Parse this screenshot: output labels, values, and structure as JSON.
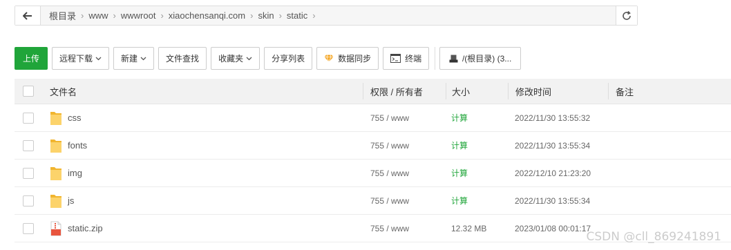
{
  "breadcrumb": [
    "根目录",
    "www",
    "wwwroot",
    "xiaochensanqi.com",
    "skin",
    "static"
  ],
  "toolbar": {
    "upload": "上传",
    "remote_download": "远程下载",
    "new": "新建",
    "file_search": "文件查找",
    "favorites": "收藏夹",
    "share_list": "分享列表",
    "data_sync": "数据同步",
    "terminal": "终端",
    "disk": "/(根目录) (3..."
  },
  "columns": {
    "name": "文件名",
    "perm": "权限 / 所有者",
    "size": "大小",
    "time": "修改时间",
    "note": "备注"
  },
  "files": [
    {
      "name": "css",
      "type": "folder",
      "perm": "755 / www",
      "size": "计算",
      "time": "2022/11/30 13:55:32"
    },
    {
      "name": "fonts",
      "type": "folder",
      "perm": "755 / www",
      "size": "计算",
      "time": "2022/11/30 13:55:34"
    },
    {
      "name": "img",
      "type": "folder",
      "perm": "755 / www",
      "size": "计算",
      "time": "2022/12/10 21:23:20"
    },
    {
      "name": "js",
      "type": "folder",
      "perm": "755 / www",
      "size": "计算",
      "time": "2022/11/30 13:55:34"
    },
    {
      "name": "static.zip",
      "type": "zip",
      "perm": "755 / www",
      "size": "12.32 MB",
      "time": "2023/01/08 00:01:17"
    }
  ],
  "watermark": "CSDN @cll_869241891",
  "colors": {
    "accent": "#20a53a",
    "folder": "#f6c24b",
    "zip": "#e8553e"
  }
}
